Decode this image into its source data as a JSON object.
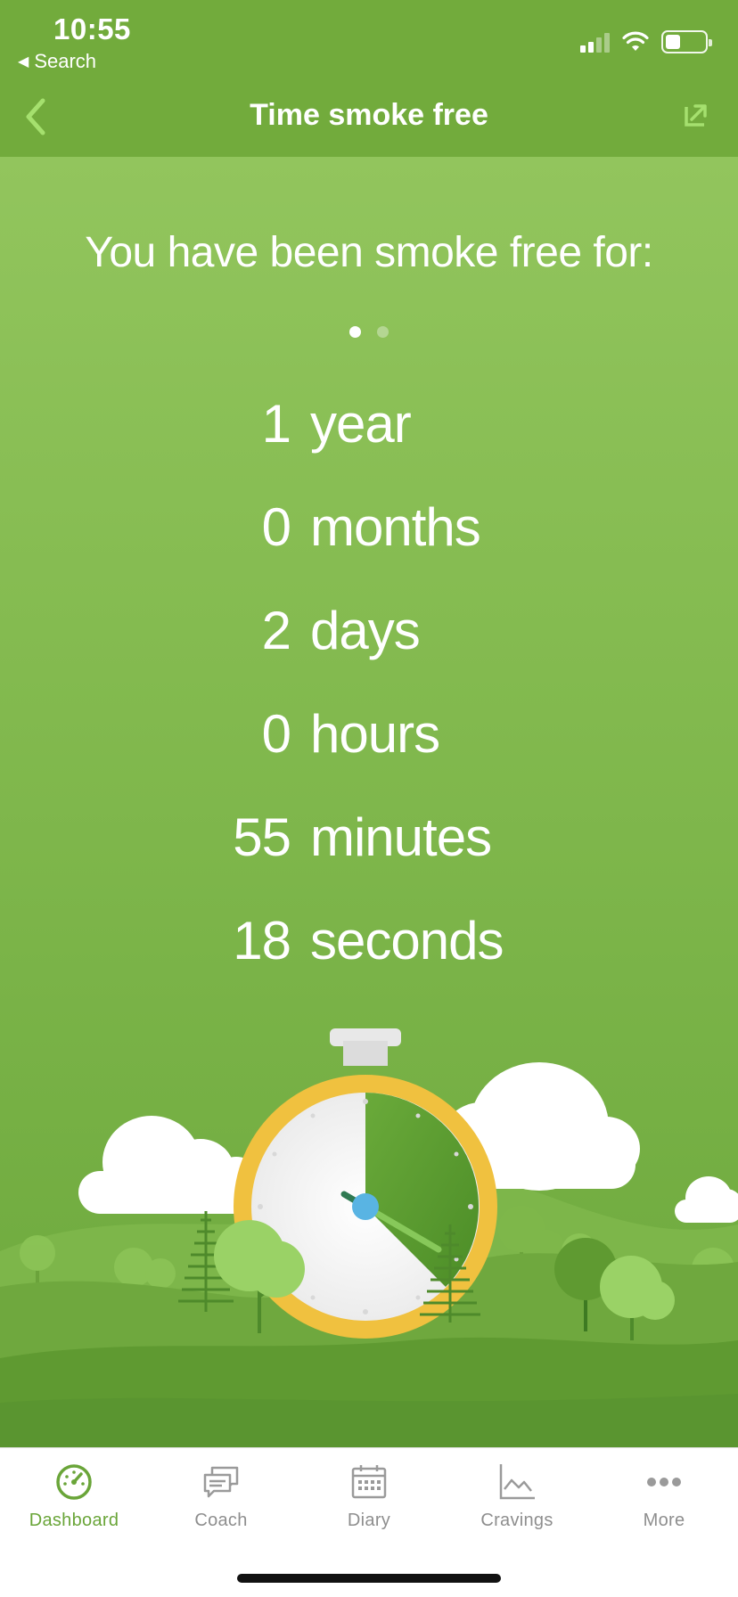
{
  "status_bar": {
    "time": "10:55",
    "back_label": "Search"
  },
  "nav": {
    "title": "Time smoke free"
  },
  "main": {
    "headline": "You have been smoke free for:",
    "pager": {
      "count": 2,
      "active": 0
    },
    "elapsed": [
      {
        "value": "1",
        "unit": "year"
      },
      {
        "value": "0",
        "unit": "months"
      },
      {
        "value": "2",
        "unit": "days"
      },
      {
        "value": "0",
        "unit": "hours"
      },
      {
        "value": "55",
        "unit": "minutes"
      },
      {
        "value": "18",
        "unit": "seconds"
      }
    ]
  },
  "tabs": [
    {
      "label": "Dashboard",
      "icon": "gauge-icon",
      "active": true
    },
    {
      "label": "Coach",
      "icon": "chat-bubbles-icon",
      "active": false
    },
    {
      "label": "Diary",
      "icon": "calendar-icon",
      "active": false
    },
    {
      "label": "Cravings",
      "icon": "line-chart-icon",
      "active": false
    },
    {
      "label": "More",
      "icon": "ellipsis-icon",
      "active": false
    }
  ],
  "colors": {
    "header": "#72ab3c",
    "accent": "#6aa539",
    "back_arrow": "#a5e06e",
    "tab_inactive": "#8e8e8e",
    "stopwatch_ring": "#f0c13f",
    "stopwatch_hand": "#59b4e3"
  }
}
